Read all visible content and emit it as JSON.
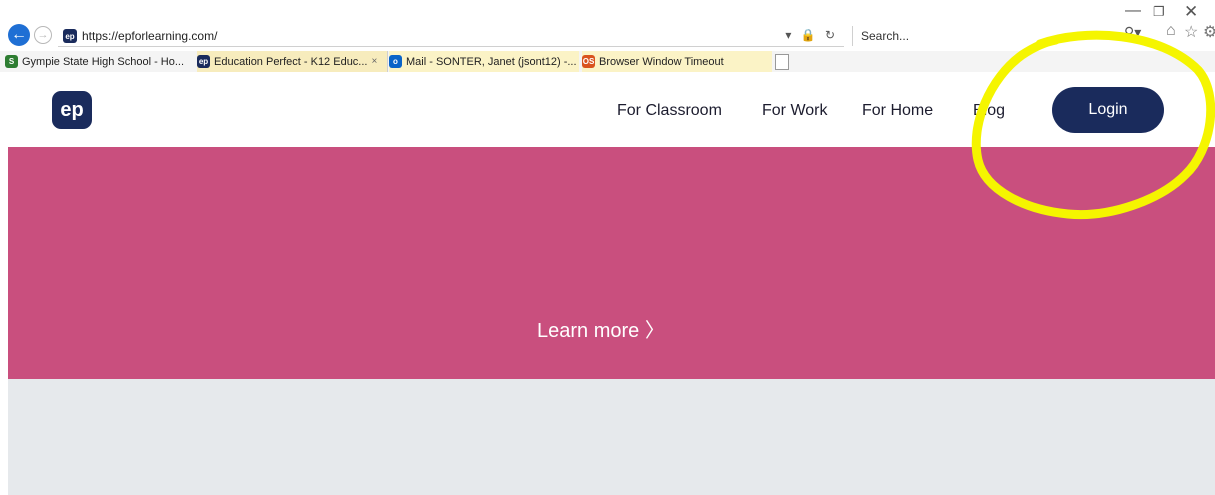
{
  "browser": {
    "url": "https://epforlearning.com/",
    "search_placeholder": "Search...",
    "favicon_text": "ep",
    "tabs": [
      {
        "label": "Gympie State High School - Ho...",
        "icon_text": "S",
        "icon_color": "#2e7d32",
        "icon": "sharepoint-icon"
      },
      {
        "label": "Education Perfect - K12 Educ...",
        "icon_text": "ep",
        "icon_color": "#1a2b5c",
        "icon": "ep-icon",
        "close": "×"
      },
      {
        "label": "Mail - SONTER, Janet (jsont12) -...",
        "icon_text": "o",
        "icon_color": "#0a64c8",
        "icon": "outlook-icon"
      },
      {
        "label": "Browser Window Timeout",
        "icon_text": "OS",
        "icon_color": "#d9531e",
        "icon": "office-icon"
      }
    ]
  },
  "site": {
    "logo_text": "ep",
    "nav": {
      "classroom": "For Classroom",
      "work": "For Work",
      "home": "For Home",
      "blog": "Blog"
    },
    "login_label": "Login",
    "hero": {
      "cta": "Learn more 〉",
      "color": "#c94f7e"
    },
    "brand_color": "#1a2b5c"
  },
  "annotation": {
    "color": "#f5f500"
  }
}
